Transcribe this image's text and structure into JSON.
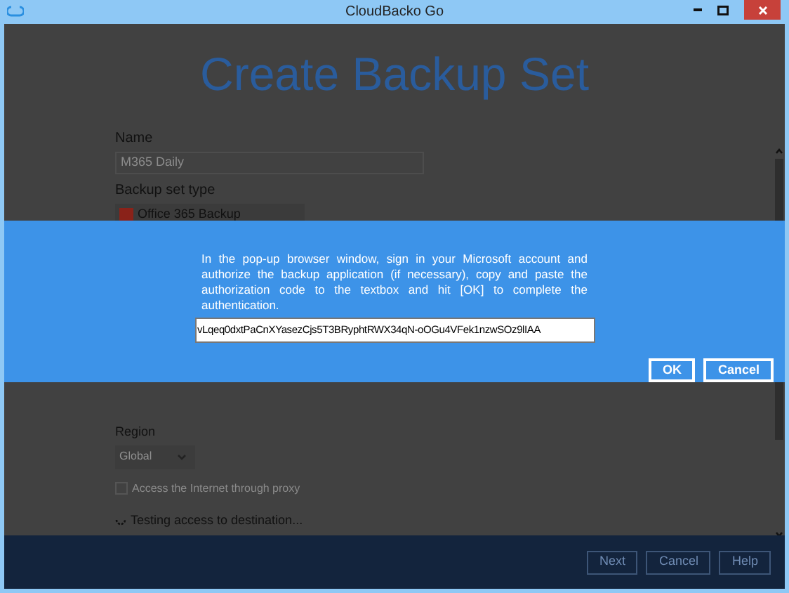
{
  "window": {
    "title": "CloudBacko Go"
  },
  "page": {
    "title": "Create Backup Set",
    "name": {
      "label": "Name",
      "value": "M365 Daily"
    },
    "backup_set_type": {
      "label": "Backup set type",
      "value": "Office 365 Backup"
    },
    "region": {
      "label": "Region",
      "value": "Global"
    },
    "proxy": {
      "label": "Access the Internet through proxy",
      "checked": false
    },
    "status": "Testing access to destination..."
  },
  "dialog": {
    "message": "In the pop-up browser window, sign in your Microsoft account and authorize the backup application (if necessary), copy and paste the authorization code to the textbox and hit [OK] to complete the authentication.",
    "code": "vLqeq0dxtPaCnXYasezCjs5T3BRyphtRWX34qN-oOGu4VFek1nzwSOz9lIAA",
    "buttons": [
      "OK",
      "Cancel"
    ]
  },
  "footer": {
    "buttons": [
      "Next",
      "Cancel",
      "Help"
    ]
  }
}
